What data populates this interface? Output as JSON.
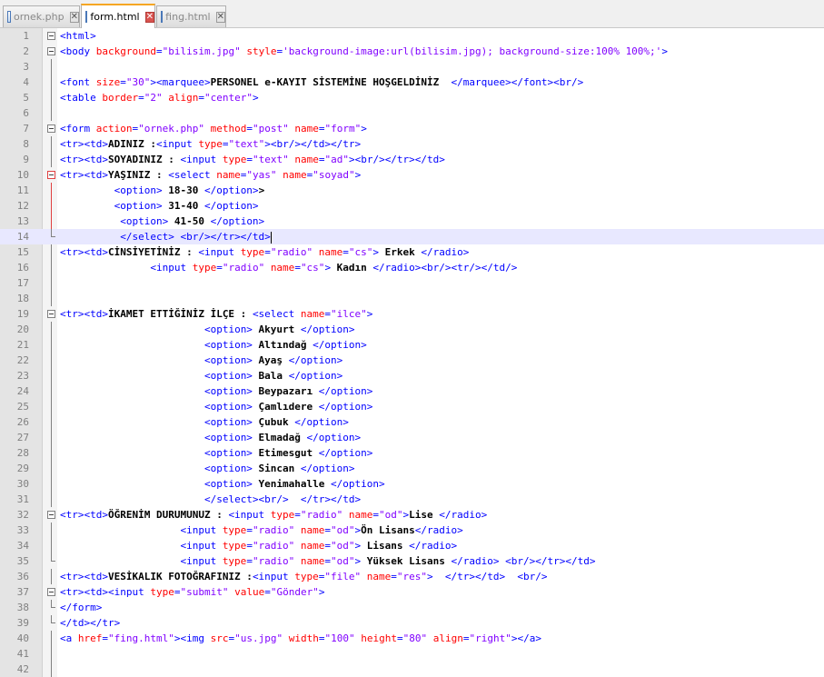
{
  "tabs": [
    {
      "label": "ornek.php",
      "active": false
    },
    {
      "label": "form.html",
      "active": true
    },
    {
      "label": "fing.html",
      "active": false
    }
  ],
  "editor": {
    "current_line": 14,
    "lines": [
      [
        [
          "t",
          "<html>"
        ]
      ],
      [
        [
          "t",
          "<body "
        ],
        [
          "a",
          "background"
        ],
        [
          "t",
          "="
        ],
        [
          "v",
          "\"bilisim.jpg\""
        ],
        [
          "t",
          " "
        ],
        [
          "a",
          "style"
        ],
        [
          "t",
          "="
        ],
        [
          "v",
          "'background-image:url(bilisim.jpg); background-size:100% 100%;'"
        ],
        [
          "t",
          ">"
        ]
      ],
      [],
      [
        [
          "t",
          "<font "
        ],
        [
          "a",
          "size"
        ],
        [
          "t",
          "="
        ],
        [
          "v",
          "\"30\""
        ],
        [
          "t",
          "><marquee>"
        ],
        [
          "x",
          "PERSONEL e-KAYIT SİSTEMİNE HOŞGELDİNİZ  "
        ],
        [
          "t",
          "</marquee></font><br/>"
        ]
      ],
      [
        [
          "t",
          "<table "
        ],
        [
          "a",
          "border"
        ],
        [
          "t",
          "="
        ],
        [
          "v",
          "\"2\""
        ],
        [
          "t",
          " "
        ],
        [
          "a",
          "align"
        ],
        [
          "t",
          "="
        ],
        [
          "v",
          "\"center\""
        ],
        [
          "t",
          ">"
        ]
      ],
      [],
      [
        [
          "t",
          "<form "
        ],
        [
          "a",
          "action"
        ],
        [
          "t",
          "="
        ],
        [
          "v",
          "\"ornek.php\""
        ],
        [
          "t",
          " "
        ],
        [
          "a",
          "method"
        ],
        [
          "t",
          "="
        ],
        [
          "v",
          "\"post\""
        ],
        [
          "t",
          " "
        ],
        [
          "a",
          "name"
        ],
        [
          "t",
          "="
        ],
        [
          "v",
          "\"form\""
        ],
        [
          "t",
          ">"
        ]
      ],
      [
        [
          "t",
          "<tr><td>"
        ],
        [
          "x",
          "ADINIZ :"
        ],
        [
          "t",
          "<input "
        ],
        [
          "a",
          "type"
        ],
        [
          "t",
          "="
        ],
        [
          "v",
          "\"text\""
        ],
        [
          "t",
          "><br/></td></tr>"
        ]
      ],
      [
        [
          "t",
          "<tr><td>"
        ],
        [
          "x",
          "SOYADINIZ : "
        ],
        [
          "t",
          "<input "
        ],
        [
          "a",
          "type"
        ],
        [
          "t",
          "="
        ],
        [
          "v",
          "\"text\""
        ],
        [
          "t",
          " "
        ],
        [
          "a",
          "name"
        ],
        [
          "t",
          "="
        ],
        [
          "v",
          "\"ad\""
        ],
        [
          "t",
          "><br/></tr></td>"
        ]
      ],
      [
        [
          "t",
          "<tr><td>"
        ],
        [
          "x",
          "YAŞINIZ : "
        ],
        [
          "t",
          "<select "
        ],
        [
          "a",
          "name"
        ],
        [
          "t",
          "="
        ],
        [
          "v",
          "\"yas\""
        ],
        [
          "t",
          " "
        ],
        [
          "a",
          "name"
        ],
        [
          "t",
          "="
        ],
        [
          "v",
          "\"soyad\""
        ],
        [
          "t",
          ">"
        ]
      ],
      [
        [
          "s",
          "         "
        ],
        [
          "t",
          "<option>"
        ],
        [
          "x",
          " 18-30 "
        ],
        [
          "t",
          "</option>"
        ],
        [
          "x",
          ">"
        ]
      ],
      [
        [
          "s",
          "         "
        ],
        [
          "t",
          "<option>"
        ],
        [
          "x",
          " 31-40 "
        ],
        [
          "t",
          "</option>"
        ]
      ],
      [
        [
          "s",
          "          "
        ],
        [
          "t",
          "<option>"
        ],
        [
          "x",
          " 41-50 "
        ],
        [
          "t",
          "</option>"
        ]
      ],
      [
        [
          "s",
          "          "
        ],
        [
          "t",
          "</select> <br/></tr></td>"
        ],
        [
          "c",
          ""
        ]
      ],
      [
        [
          "t",
          "<tr><td>"
        ],
        [
          "x",
          "CİNSİYETİNİZ : "
        ],
        [
          "t",
          "<input "
        ],
        [
          "a",
          "type"
        ],
        [
          "t",
          "="
        ],
        [
          "v",
          "\"radio\""
        ],
        [
          "t",
          " "
        ],
        [
          "a",
          "name"
        ],
        [
          "t",
          "="
        ],
        [
          "v",
          "\"cs\""
        ],
        [
          "t",
          ">"
        ],
        [
          "x",
          " Erkek "
        ],
        [
          "t",
          "</radio>"
        ]
      ],
      [
        [
          "s",
          "               "
        ],
        [
          "t",
          "<input "
        ],
        [
          "a",
          "type"
        ],
        [
          "t",
          "="
        ],
        [
          "v",
          "\"radio\""
        ],
        [
          "t",
          " "
        ],
        [
          "a",
          "name"
        ],
        [
          "t",
          "="
        ],
        [
          "v",
          "\"cs\""
        ],
        [
          "t",
          ">"
        ],
        [
          "x",
          " Kadın "
        ],
        [
          "t",
          "</radio><br/><tr/></td/>"
        ]
      ],
      [],
      [],
      [
        [
          "t",
          "<tr><td>"
        ],
        [
          "x",
          "İKAMET ETTİĞİNİZ İLÇE : "
        ],
        [
          "t",
          "<select "
        ],
        [
          "a",
          "name"
        ],
        [
          "t",
          "="
        ],
        [
          "v",
          "\"ilce\""
        ],
        [
          "t",
          ">"
        ]
      ],
      [
        [
          "s",
          "                        "
        ],
        [
          "t",
          "<option>"
        ],
        [
          "x",
          " Akyurt "
        ],
        [
          "t",
          "</option>"
        ]
      ],
      [
        [
          "s",
          "                        "
        ],
        [
          "t",
          "<option>"
        ],
        [
          "x",
          " Altındağ "
        ],
        [
          "t",
          "</option>"
        ]
      ],
      [
        [
          "s",
          "                        "
        ],
        [
          "t",
          "<option>"
        ],
        [
          "x",
          " Ayaş "
        ],
        [
          "t",
          "</option>"
        ]
      ],
      [
        [
          "s",
          "                        "
        ],
        [
          "t",
          "<option>"
        ],
        [
          "x",
          " Bala "
        ],
        [
          "t",
          "</option>"
        ]
      ],
      [
        [
          "s",
          "                        "
        ],
        [
          "t",
          "<option>"
        ],
        [
          "x",
          " Beypazarı "
        ],
        [
          "t",
          "</option>"
        ]
      ],
      [
        [
          "s",
          "                        "
        ],
        [
          "t",
          "<option>"
        ],
        [
          "x",
          " Çamlıdere "
        ],
        [
          "t",
          "</option>"
        ]
      ],
      [
        [
          "s",
          "                        "
        ],
        [
          "t",
          "<option>"
        ],
        [
          "x",
          " Çubuk "
        ],
        [
          "t",
          "</option>"
        ]
      ],
      [
        [
          "s",
          "                        "
        ],
        [
          "t",
          "<option>"
        ],
        [
          "x",
          " Elmadağ "
        ],
        [
          "t",
          "</option>"
        ]
      ],
      [
        [
          "s",
          "                        "
        ],
        [
          "t",
          "<option>"
        ],
        [
          "x",
          " Etimesgut "
        ],
        [
          "t",
          "</option>"
        ]
      ],
      [
        [
          "s",
          "                        "
        ],
        [
          "t",
          "<option>"
        ],
        [
          "x",
          " Sincan "
        ],
        [
          "t",
          "</option>"
        ]
      ],
      [
        [
          "s",
          "                        "
        ],
        [
          "t",
          "<option>"
        ],
        [
          "x",
          " Yenimahalle "
        ],
        [
          "t",
          "</option>"
        ]
      ],
      [
        [
          "s",
          "                        "
        ],
        [
          "t",
          "</select><br/>  </tr></td>"
        ]
      ],
      [
        [
          "t",
          "<tr><td>"
        ],
        [
          "x",
          "ÖĞRENİM DURUMUNUZ : "
        ],
        [
          "t",
          "<input "
        ],
        [
          "a",
          "type"
        ],
        [
          "t",
          "="
        ],
        [
          "v",
          "\"radio\""
        ],
        [
          "t",
          " "
        ],
        [
          "a",
          "name"
        ],
        [
          "t",
          "="
        ],
        [
          "v",
          "\"od\""
        ],
        [
          "t",
          ">"
        ],
        [
          "x",
          "Lise "
        ],
        [
          "t",
          "</radio>"
        ]
      ],
      [
        [
          "s",
          "                    "
        ],
        [
          "t",
          "<input "
        ],
        [
          "a",
          "type"
        ],
        [
          "t",
          "="
        ],
        [
          "v",
          "\"radio\""
        ],
        [
          "t",
          " "
        ],
        [
          "a",
          "name"
        ],
        [
          "t",
          "="
        ],
        [
          "v",
          "\"od\""
        ],
        [
          "t",
          ">"
        ],
        [
          "x",
          "Ön Lisans"
        ],
        [
          "t",
          "</radio>"
        ]
      ],
      [
        [
          "s",
          "                    "
        ],
        [
          "t",
          "<input "
        ],
        [
          "a",
          "type"
        ],
        [
          "t",
          "="
        ],
        [
          "v",
          "\"radio\""
        ],
        [
          "t",
          " "
        ],
        [
          "a",
          "name"
        ],
        [
          "t",
          "="
        ],
        [
          "v",
          "\"od\""
        ],
        [
          "t",
          ">"
        ],
        [
          "x",
          " Lisans "
        ],
        [
          "t",
          "</radio>"
        ]
      ],
      [
        [
          "s",
          "                    "
        ],
        [
          "t",
          "<input "
        ],
        [
          "a",
          "type"
        ],
        [
          "t",
          "="
        ],
        [
          "v",
          "\"radio\""
        ],
        [
          "t",
          " "
        ],
        [
          "a",
          "name"
        ],
        [
          "t",
          "="
        ],
        [
          "v",
          "\"od\""
        ],
        [
          "t",
          ">"
        ],
        [
          "x",
          " Yüksek Lisans "
        ],
        [
          "t",
          "</radio> <br/></tr></td>"
        ]
      ],
      [
        [
          "t",
          "<tr><td>"
        ],
        [
          "x",
          "VESİKALIK FOTOĞRAFINIZ :"
        ],
        [
          "t",
          "<input "
        ],
        [
          "a",
          "type"
        ],
        [
          "t",
          "="
        ],
        [
          "v",
          "\"file\""
        ],
        [
          "t",
          " "
        ],
        [
          "a",
          "name"
        ],
        [
          "t",
          "="
        ],
        [
          "v",
          "\"res\""
        ],
        [
          "t",
          ">  </tr></td>  <br/>"
        ]
      ],
      [
        [
          "t",
          "<tr><td><input "
        ],
        [
          "a",
          "type"
        ],
        [
          "t",
          "="
        ],
        [
          "v",
          "\"submit\""
        ],
        [
          "t",
          " "
        ],
        [
          "a",
          "value"
        ],
        [
          "t",
          "="
        ],
        [
          "v",
          "\"Gönder\""
        ],
        [
          "t",
          ">"
        ]
      ],
      [
        [
          "t",
          "</form>"
        ]
      ],
      [
        [
          "t",
          "</td></tr>"
        ]
      ],
      [
        [
          "t",
          "<a "
        ],
        [
          "a",
          "href"
        ],
        [
          "t",
          "="
        ],
        [
          "v",
          "\"fing.html\""
        ],
        [
          "t",
          "><img "
        ],
        [
          "a",
          "src"
        ],
        [
          "t",
          "="
        ],
        [
          "v",
          "\"us.jpg\""
        ],
        [
          "t",
          " "
        ],
        [
          "a",
          "width"
        ],
        [
          "t",
          "="
        ],
        [
          "v",
          "\"100\""
        ],
        [
          "t",
          " "
        ],
        [
          "a",
          "height"
        ],
        [
          "t",
          "="
        ],
        [
          "v",
          "\"80\""
        ],
        [
          "t",
          " "
        ],
        [
          "a",
          "align"
        ],
        [
          "t",
          "="
        ],
        [
          "v",
          "\"right\""
        ],
        [
          "t",
          "></a>"
        ]
      ],
      [],
      []
    ]
  }
}
